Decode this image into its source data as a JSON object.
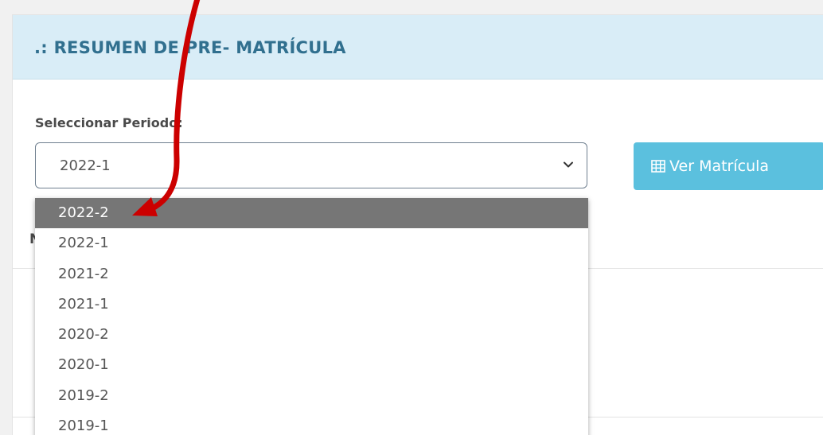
{
  "panel": {
    "title": ".: RESUMEN DE PRE- MATRÍCULA"
  },
  "form": {
    "period_label": "Seleccionar Periodo:",
    "selected_value": "2022-1",
    "view_button_label": "Ver Matrícula",
    "partial_text": "N"
  },
  "dropdown": {
    "options": [
      "2022-2",
      "2022-1",
      "2021-2",
      "2021-1",
      "2020-2",
      "2020-1",
      "2019-2",
      "2019-1"
    ],
    "highlighted_option": "2022-2"
  },
  "icons": {
    "select_indicator": "chevron-down-icon",
    "button_icon": "table-icon",
    "annotation": "red-arrow"
  },
  "colors": {
    "header_bg": "#d9edf7",
    "title_text": "#31708f",
    "button_bg": "#5bc0de",
    "highlight_bg": "#767676",
    "annotation_arrow": "#cc0000"
  }
}
